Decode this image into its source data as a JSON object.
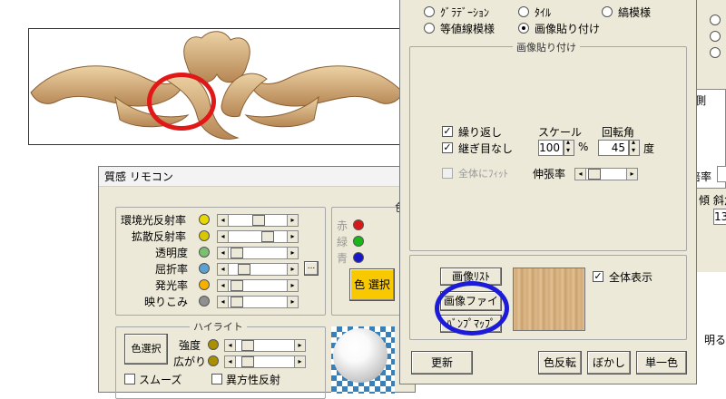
{
  "remote": {
    "title": "質感 リモコン",
    "rows": [
      {
        "label": "環境光反射率",
        "color": "#e8d800"
      },
      {
        "label": "拡散反射率",
        "color": "#d8c800"
      },
      {
        "label": "透明度",
        "color": "#7ac070"
      },
      {
        "label": "屈折率",
        "color": "#5aa0d0"
      },
      {
        "label": "発光率",
        "color": "#f5b000"
      },
      {
        "label": "映りこみ",
        "color": "#909090"
      }
    ],
    "rgb_red": "赤",
    "rgb_green": "緑",
    "rgb_blue": "青",
    "color_fragment": "色",
    "color_select_button": "色 選択",
    "highlight_label": "ハイライト",
    "highlight_color_button": "色選択",
    "intensity_label": "強度",
    "spread_label": "広がり",
    "smooth_label": "スムーズ",
    "anisotropic_label": "異方性反射",
    "ellipsis": "..."
  },
  "texture": {
    "radios": [
      {
        "label": "ｸﾞﾗﾃﾞｰｼｮﾝ",
        "on": false
      },
      {
        "label": "ﾀｲﾙ",
        "on": false
      },
      {
        "label": "縞模様",
        "on": false
      },
      {
        "label": "等値線模様",
        "on": false
      },
      {
        "label": "画像貼り付け",
        "on": true
      }
    ],
    "group_label": "画像貼り付け",
    "repeat_label": "繰り返し",
    "seamless_label": "継ぎ目なし",
    "fit_label": "全体にﾌｨｯﾄ",
    "scale_label": "スケール",
    "rotation_label": "回転角",
    "scale_value": "100",
    "percent": "%",
    "rotation_value": "45",
    "degree": "度",
    "stretch_label": "伸張率",
    "image_list_button": "画像ﾘｽﾄ",
    "image_file_button": "画像ファイル",
    "bump_map_button": "ﾊﾞﾝﾌﾟﾏｯﾌﾟ",
    "show_all_label": "全体表示",
    "update_button": "更新",
    "invert_button": "色反転",
    "blur_button": "ぼかし",
    "mono_button": "単一色"
  },
  "right_fragments": {
    "side_label": "側",
    "ratio_label": "倍率",
    "incline_label": "傾 斜角",
    "value_1": "13",
    "brightness_label": "明る"
  },
  "colors": {
    "annotation_red": "#e01818",
    "annotation_blue": "#1c1cd8",
    "wood_light": "#dcb88a",
    "wood_dark": "#a77a4a"
  }
}
